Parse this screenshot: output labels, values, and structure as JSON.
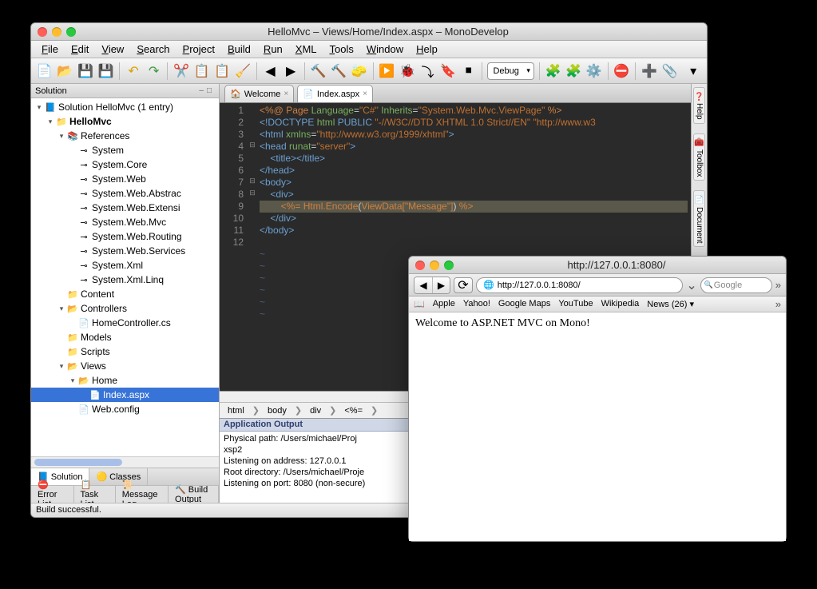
{
  "ide": {
    "title": "HelloMvc – Views/Home/Index.aspx – MonoDevelop",
    "menu": [
      "File",
      "Edit",
      "View",
      "Search",
      "Project",
      "Build",
      "Run",
      "XML",
      "Tools",
      "Window",
      "Help"
    ],
    "config": "Debug",
    "status": "Build successful."
  },
  "solution": {
    "header": "Solution",
    "root": "Solution HelloMvc (1 entry)",
    "project": "HelloMvc",
    "refs_label": "References",
    "refs": [
      "System",
      "System.Core",
      "System.Web",
      "System.Web.Abstrac",
      "System.Web.Extensi",
      "System.Web.Mvc",
      "System.Web.Routing",
      "System.Web.Services",
      "System.Xml",
      "System.Xml.Linq"
    ],
    "content": "Content",
    "controllers": "Controllers",
    "homecontroller": "HomeController.cs",
    "models": "Models",
    "scripts": "Scripts",
    "views": "Views",
    "home": "Home",
    "index": "Index.aspx",
    "webconfig": "Web.config",
    "tabs": [
      "Solution",
      "Classes"
    ]
  },
  "doc_tabs": [
    {
      "label": "Welcome"
    },
    {
      "label": "Index.aspx"
    }
  ],
  "editor": {
    "lines": [
      {
        "n": 1,
        "seg": [
          {
            "c": "pct",
            "t": "<%@ "
          },
          {
            "c": "dir",
            "t": "Page"
          },
          {
            "c": "",
            "t": " "
          },
          {
            "c": "attr",
            "t": "Language"
          },
          {
            "c": "",
            "t": "="
          },
          {
            "c": "str",
            "t": "\"C#\""
          },
          {
            "c": "",
            "t": " "
          },
          {
            "c": "attr",
            "t": "Inherits"
          },
          {
            "c": "",
            "t": "="
          },
          {
            "c": "str",
            "t": "\"System.Web.Mvc.ViewPage\""
          },
          {
            "c": "pct",
            "t": " %>"
          }
        ]
      },
      {
        "n": 2,
        "seg": [
          {
            "c": "tag",
            "t": "<!DOCTYPE "
          },
          {
            "c": "attr",
            "t": "html"
          },
          {
            "c": "tag",
            "t": " PUBLIC"
          },
          {
            "c": "",
            "t": " "
          },
          {
            "c": "str",
            "t": "\"-//W3C//DTD XHTML 1.0 Strict//EN\" \"http://www.w3"
          }
        ]
      },
      {
        "n": 3,
        "seg": [
          {
            "c": "tag",
            "t": "<html"
          },
          {
            "c": "",
            "t": " "
          },
          {
            "c": "attr",
            "t": "xmlns"
          },
          {
            "c": "",
            "t": "="
          },
          {
            "c": "str",
            "t": "\"http://www.w3.org/1999/xhtml\""
          },
          {
            "c": "tag",
            "t": ">"
          }
        ]
      },
      {
        "n": 4,
        "fold": "⊟",
        "seg": [
          {
            "c": "tag",
            "t": "<head"
          },
          {
            "c": "",
            "t": " "
          },
          {
            "c": "attr",
            "t": "runat"
          },
          {
            "c": "",
            "t": "="
          },
          {
            "c": "str",
            "t": "\"server\""
          },
          {
            "c": "tag",
            "t": ">"
          }
        ]
      },
      {
        "n": 5,
        "seg": [
          {
            "c": "",
            "t": "    "
          },
          {
            "c": "tag",
            "t": "<title></title>"
          }
        ]
      },
      {
        "n": 6,
        "seg": [
          {
            "c": "tag",
            "t": "</head>"
          }
        ]
      },
      {
        "n": 7,
        "fold": "⊟",
        "seg": [
          {
            "c": "tag",
            "t": "<body>"
          }
        ]
      },
      {
        "n": 8,
        "fold": "⊟",
        "seg": [
          {
            "c": "",
            "t": "    "
          },
          {
            "c": "tag",
            "t": "<div>"
          }
        ]
      },
      {
        "n": 9,
        "hl": true,
        "seg": [
          {
            "c": "",
            "t": "        "
          },
          {
            "c": "pct",
            "t": "<%="
          },
          {
            "c": "",
            "t": " "
          },
          {
            "c": "dir",
            "t": "Html.Encode"
          },
          {
            "c": "",
            "t": "("
          },
          {
            "c": "dir",
            "t": "ViewData[\"Message\"]"
          },
          {
            "c": "",
            "t": ") "
          },
          {
            "c": "pct",
            "t": "%>"
          }
        ]
      },
      {
        "n": 10,
        "seg": [
          {
            "c": "",
            "t": "    "
          },
          {
            "c": "tag",
            "t": "</div>"
          }
        ]
      },
      {
        "n": 11,
        "seg": [
          {
            "c": "tag",
            "t": "</body>"
          }
        ]
      },
      {
        "n": 12,
        "seg": [
          {
            "c": "",
            "t": ""
          }
        ]
      }
    ],
    "tildes": 6
  },
  "breadcrumb": [
    "html",
    "body",
    "div",
    "<%="
  ],
  "output": {
    "title": "Application Output",
    "lines": [
      "Physical path: /Users/michael/Proj",
      "xsp2",
      "Listening on address: 127.0.0.1",
      "Root directory: /Users/michael/Proje",
      "Listening on port: 8080 (non-secure)"
    ]
  },
  "bottom_tabs": [
    "Error List",
    "Task List",
    "Message Log",
    "Build Output"
  ],
  "side_tabs": [
    "Help",
    "Toolbox",
    "Document"
  ],
  "browser": {
    "title": "http://127.0.0.1:8080/",
    "url": "http://127.0.0.1:8080/",
    "search_placeholder": "Google",
    "bookmarks": [
      "Apple",
      "Yahoo!",
      "Google Maps",
      "YouTube",
      "Wikipedia",
      "News (26) ▾"
    ],
    "body": "Welcome to ASP.NET MVC on Mono!"
  }
}
